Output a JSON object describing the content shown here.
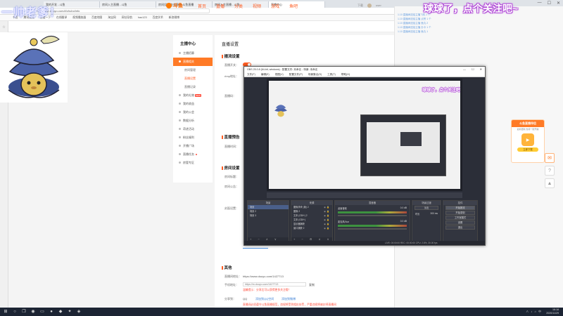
{
  "browser": {
    "tabs": [
      "我的开发 - 斗鱼",
      "房间入主直播 - 斗鱼",
      "房间设置 在线直播 斗鱼直播",
      "房间入主直播 - 斗鱼",
      "直播中心"
    ],
    "url": "https://mp.douyu.com/#/zhubo/info",
    "window_controls": [
      "—",
      "☐",
      "✕"
    ],
    "bookmarks": [
      "书签",
      "腾讯视频",
      "百度一下",
      "在线翻译",
      "视频播放器",
      "百度地图",
      "淘宝网",
      "网址导航",
      "hao123",
      "百度学术",
      "新浪微博"
    ]
  },
  "overlays": {
    "top_left": "一帅老爹！",
    "top_right": "球球了，点个关注吧~"
  },
  "site": {
    "logo": "斗鱼",
    "nav": [
      "首页",
      "直播",
      "分类",
      "视频",
      "游戏",
      "鱼吧"
    ],
    "header_right": [
      "下载",
      "user"
    ]
  },
  "sidebar": {
    "title": "主播中心",
    "items": [
      {
        "label": "主播招募",
        "type": "item"
      },
      {
        "label": "直播相关",
        "type": "active"
      },
      {
        "label": "房间管理",
        "type": "sub"
      },
      {
        "label": "直播设置",
        "type": "sub-active"
      },
      {
        "label": "直播记录",
        "type": "sub"
      },
      {
        "label": "我的礼物",
        "type": "item",
        "badge": "NEW"
      },
      {
        "label": "我的收益",
        "type": "item"
      },
      {
        "label": "我的公会",
        "type": "item"
      },
      {
        "label": "数据分析",
        "type": "item"
      },
      {
        "label": "奇迹活动",
        "type": "item"
      },
      {
        "label": "粉丝福利",
        "type": "item"
      },
      {
        "label": "开播广场",
        "type": "item"
      },
      {
        "label": "直播任务",
        "type": "item",
        "dot": true
      },
      {
        "label": "房管专区",
        "type": "item"
      }
    ]
  },
  "content": {
    "page_title": "直播设置",
    "sections": {
      "basic": "播流设置",
      "notice": "直播预告",
      "room": "房间设置",
      "other": "其他"
    },
    "labels": {
      "live_switch": "直播开关：",
      "rtmp": "rtmp地址：",
      "stream_code": "直播码：",
      "notice_time": "直播时间：",
      "room_name": "房间标题：",
      "room_notice": "房间公告：",
      "room_cover": "封面设置：",
      "room_link": "直播间地址：",
      "mobile_link": "手机地址：",
      "share": "分享到："
    },
    "values": {
      "room_link": "https://www.douyu.com/1427713",
      "mobile_link": "https://m.douyu.com/1427713",
      "copy": "复制",
      "share_warn": "温馨提示：分享后可以获得更多关注哦！",
      "qq": "QQ",
      "link1": "添加到QQ空间",
      "link2": "添加到微博",
      "bottom_warn": "直播间必须遵守斗鱼直播规范，违规将受到相应处罚，严重违规将被封停直播间"
    }
  },
  "chat": {
    "lines": [
      "1.10 直播间送给主播飞机 1 个",
      "1.10 直播间送给主播 点赞 1 个",
      "1.10 直播间送给主播 鱼丸 2",
      "1.10 直播间送给主播 办卡 1 个",
      "1.10 直播间送给主播 鱼丸 1"
    ]
  },
  "promo": {
    "title": "斗鱼直播伴侣",
    "subtitle": "最新更新 支持一键开播",
    "button": "立即下载"
  },
  "obs": {
    "title": "OBS 25.0.8 (64-bit, windows) - 配置文件: 未命名 - 场景: 未命名",
    "menu": [
      "文件(F)",
      "编辑(E)",
      "视图(V)",
      "配置文件(P)",
      "场景集合(S)",
      "工具(T)",
      "帮助(H)"
    ],
    "docks": {
      "scenes": {
        "head": "场景",
        "items": [
          "场景",
          "场景 2",
          "场景 3"
        ]
      },
      "sources": {
        "head": "来源",
        "items": [
          "图像滑块 (帧) 2",
          "图像 2",
          "文本 (GDI+) 2",
          "文本 (GDI+)",
          "显示器捕获",
          "窗口捕获 2"
        ]
      },
      "mixer": {
        "head": "混音器",
        "tracks": [
          {
            "name": "桌面音频",
            "db": "0.0 dB"
          },
          {
            "name": "麦克风/Aux",
            "db": "0.0 dB"
          }
        ]
      },
      "transitions": {
        "head": "场景过渡",
        "fade": "淡出",
        "duration_label": "时长",
        "duration": "300 ms"
      },
      "controls": {
        "head": "控件",
        "buttons": [
          "开始推流",
          "开始录制",
          "工作室模式",
          "设置",
          "退出"
        ]
      }
    },
    "status": "LIVE: 00:00:00   REC: 00:00:00   CPU: 2.8%, 30.00 fps"
  },
  "taskbar": {
    "time": "16:18",
    "date": "2020/11/29"
  }
}
